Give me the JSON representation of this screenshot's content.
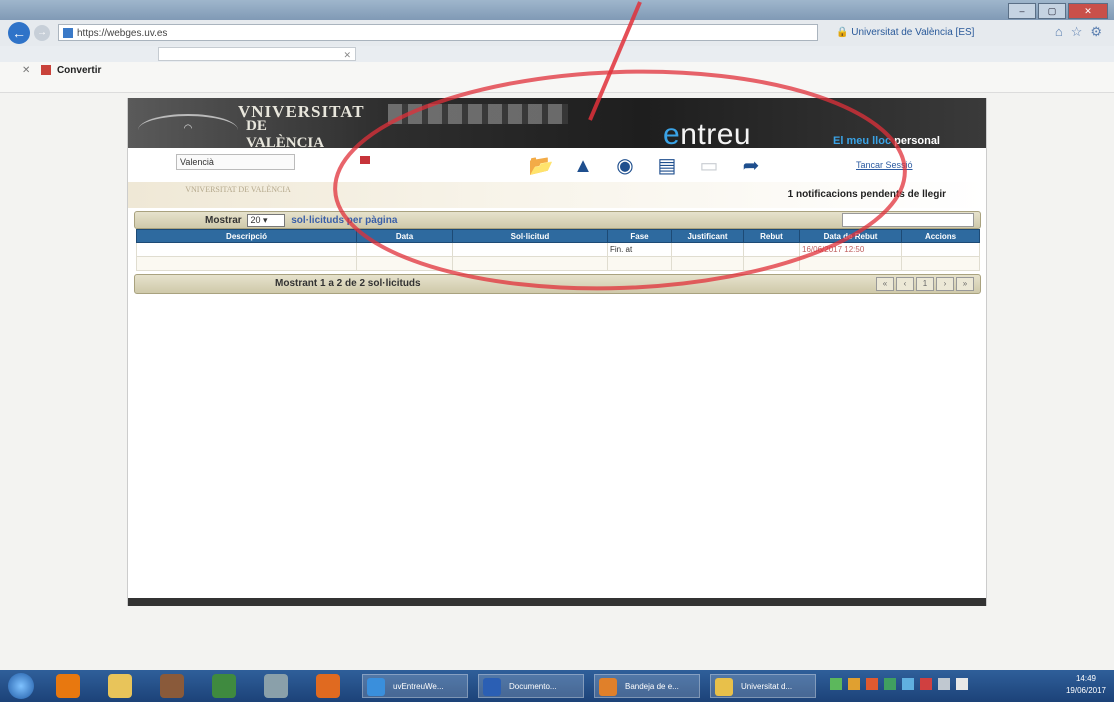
{
  "browser": {
    "url": "https://webges.uv.es",
    "site_identity": "Universitat de València [ES]",
    "tab_title": "",
    "window_buttons": [
      "–",
      "▢",
      "✕"
    ]
  },
  "command_bar": {
    "convert_label": "Convertir"
  },
  "app": {
    "university_line1": "VNIVERSITAT",
    "university_line2": "DE VALÈNCIA",
    "brand_e": "e",
    "brand_rest": "ntreu",
    "personal_prefix": "El meu lloc ",
    "personal_suffix": "personal",
    "selected_option": "Valencià",
    "close_session": "Tancar Sessió",
    "notifications": "1 notificacions pendents de llegir",
    "small_logo": "VNIVERSITAT DE VALÈNCIA"
  },
  "grid": {
    "show_prefix": "Mostrar",
    "page_size": "20",
    "show_suffix": "sol·licituds per pàgina",
    "columns": [
      "Descripció",
      "Data",
      "Sol·licitud",
      "Fase",
      "Justificant",
      "Rebut",
      "Data de Rebut",
      "Accions"
    ],
    "rows": [
      [
        "",
        "",
        "",
        "Fin. at",
        "",
        "",
        "16/06/2017 12:50",
        ""
      ],
      [
        "",
        "",
        "",
        "",
        "",
        "",
        "",
        ""
      ]
    ],
    "footer": "Mostrant 1 a 2 de 2 sol·licituds",
    "pager": [
      "«",
      "‹",
      "1",
      "›",
      "»"
    ]
  },
  "taskbar": {
    "tasks": [
      "uvEntreuWe...",
      "Documento...",
      "Bandeja de e...",
      "Universitat d..."
    ],
    "time": "14:49",
    "date": "19/06/2017"
  },
  "colors": {
    "accent_blue": "#3aa3e6",
    "table_header": "#2e6a9f",
    "annotation_red": "#e0303a"
  }
}
